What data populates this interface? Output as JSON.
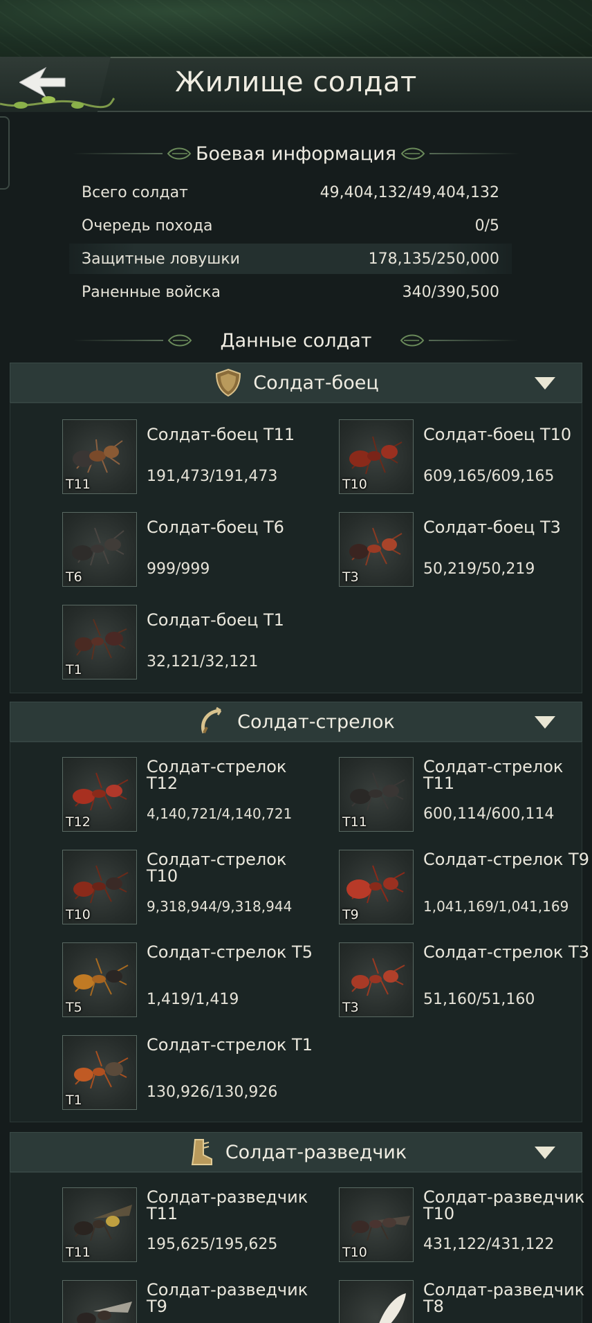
{
  "header": {
    "title": "Жилище солдат"
  },
  "battle_info": {
    "heading": "Боевая информация",
    "rows": [
      {
        "label": "Всего солдат",
        "value": "49,404,132/49,404,132"
      },
      {
        "label": "Очередь похода",
        "value": "0/5"
      },
      {
        "label": "Защитные ловушки",
        "value": "178,135/250,000"
      },
      {
        "label": "Раненные войска",
        "value": "340/390,500"
      }
    ]
  },
  "soldier_data": {
    "heading": "Данные солдат"
  },
  "categories": [
    {
      "label": "Солдат-боец",
      "icon": "shield-icon",
      "units": [
        {
          "name": "Солдат-боец T11",
          "count": "191,473/191,473",
          "tier": "T11"
        },
        {
          "name": "Солдат-боец T10",
          "count": "609,165/609,165",
          "tier": "T10"
        },
        {
          "name": "Солдат-боец T6",
          "count": "999/999",
          "tier": "T6"
        },
        {
          "name": "Солдат-боец T3",
          "count": "50,219/50,219",
          "tier": "T3"
        },
        {
          "name": "Солдат-боец T1",
          "count": "32,121/32,121",
          "tier": "T1"
        }
      ]
    },
    {
      "label": "Солдат-стрелок",
      "icon": "bow-icon",
      "units": [
        {
          "name": "Солдат-стрелок T12",
          "count": "4,140,721/4,140,721",
          "tier": "T12"
        },
        {
          "name": "Солдат-стрелок T11",
          "count": "600,114/600,114",
          "tier": "T11"
        },
        {
          "name": "Солдат-стрелок T10",
          "count": "9,318,944/9,318,944",
          "tier": "T10"
        },
        {
          "name": "Солдат-стрелок T9",
          "count": "1,041,169/1,041,169",
          "tier": "T9"
        },
        {
          "name": "Солдат-стрелок T5",
          "count": "1,419/1,419",
          "tier": "T5"
        },
        {
          "name": "Солдат-стрелок T3",
          "count": "51,160/51,160",
          "tier": "T3"
        },
        {
          "name": "Солдат-стрелок T1",
          "count": "130,926/130,926",
          "tier": "T1"
        }
      ]
    },
    {
      "label": "Солдат-разведчик",
      "icon": "boot-icon",
      "units": [
        {
          "name": "Солдат-разведчик T11",
          "count": "195,625/195,625",
          "tier": "T11"
        },
        {
          "name": "Солдат-разведчик T10",
          "count": "431,122/431,122",
          "tier": "T10"
        },
        {
          "name": "Солдат-разведчик T9",
          "count": "",
          "tier": ""
        },
        {
          "name": "Солдат-разведчик T8",
          "count": "",
          "tier": ""
        }
      ]
    }
  ],
  "colors": {
    "background": "#151c1c",
    "category_header": "#2c3a38",
    "accent_green": "#566b55",
    "chevron": "#e9e6d4"
  }
}
